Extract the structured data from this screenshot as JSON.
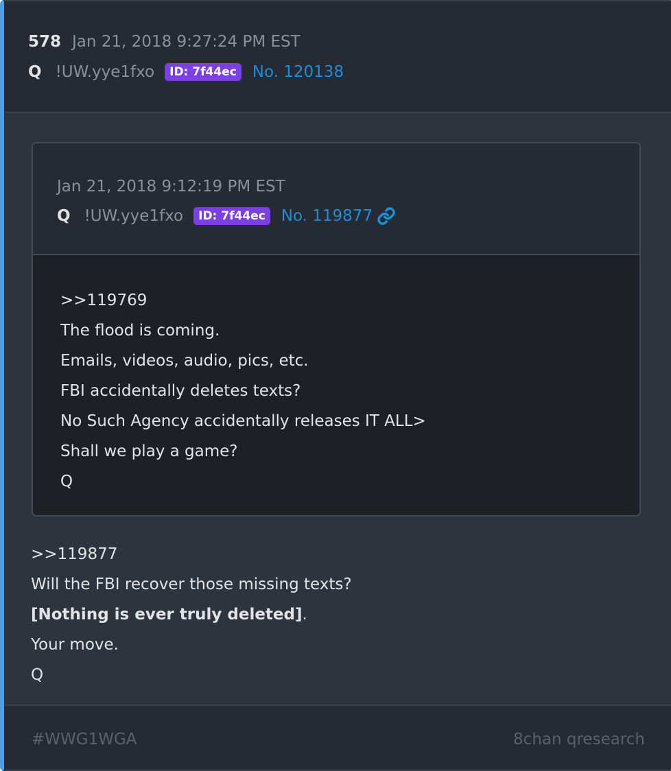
{
  "post": {
    "number": "578",
    "date": "Jan 21, 2018 9:27:24 PM EST",
    "author": "Q",
    "tripcode": "!UW.yye1fxo",
    "id_badge": "ID: 7f44ec",
    "post_no": "No. 120138"
  },
  "quoted_post": {
    "date": "Jan 21, 2018 9:12:19 PM EST",
    "author": "Q",
    "tripcode": "!UW.yye1fxo",
    "id_badge": "ID: 7f44ec",
    "post_no": "No. 119877",
    "link_icon": "link-icon",
    "body_lines": [
      ">>119769",
      "The flood is coming.",
      "Emails, videos, audio, pics, etc.",
      "FBI accidentally deletes texts?",
      "No Such Agency accidentally releases IT ALL>",
      "Shall we play a game?",
      "Q"
    ]
  },
  "body": {
    "line1": ">>119877",
    "line2": "Will the FBI recover those missing texts?",
    "line3_bold": "[Nothing is ever truly deleted]",
    "line3_tail": ".",
    "line4": "Your move.",
    "line5": "Q"
  },
  "footer": {
    "hashtag": "#WWG1WGA",
    "source": "8chan qresearch"
  },
  "colors": {
    "accent_bar": "#4aa0e6",
    "badge": "#7c3fe4",
    "link": "#1c8ed8"
  }
}
